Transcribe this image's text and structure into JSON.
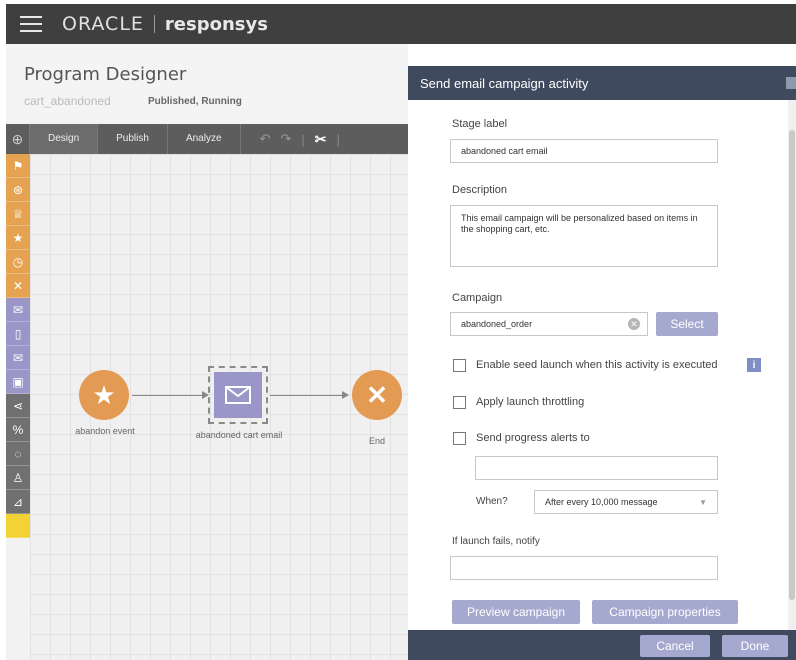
{
  "header": {
    "brand": "ORACLE",
    "product": "responsys"
  },
  "designer": {
    "title": "Program Designer",
    "program_name": "cart_abandoned",
    "status": "Published, Running",
    "tabs": [
      {
        "label": "Design"
      },
      {
        "label": "Publish"
      },
      {
        "label": "Analyze"
      }
    ],
    "toolbar_icons": [
      "undo-icon",
      "redo-icon",
      "scissors-icon"
    ],
    "palette": [
      {
        "icon": "filter-icon",
        "color": "#e5a352"
      },
      {
        "icon": "download-icon",
        "color": "#e5a352"
      },
      {
        "icon": "trophy-icon",
        "color": "#e5a352"
      },
      {
        "icon": "star-icon",
        "color": "#e5a352"
      },
      {
        "icon": "clock-icon",
        "color": "#e5a352"
      },
      {
        "icon": "close-icon",
        "color": "#e5a352"
      },
      {
        "icon": "email-icon",
        "color": "#9b96c8"
      },
      {
        "icon": "mobile-icon",
        "color": "#9b96c8"
      },
      {
        "icon": "email-icon",
        "color": "#9b96c8"
      },
      {
        "icon": "briefcase-icon",
        "color": "#9b96c8"
      },
      {
        "icon": "split-icon",
        "color": "#707070"
      },
      {
        "icon": "percent-icon",
        "color": "#707070"
      },
      {
        "icon": "dotted-circle-icon",
        "color": "#707070"
      },
      {
        "icon": "person-icon",
        "color": "#707070"
      },
      {
        "icon": "chart-icon",
        "color": "#707070"
      },
      {
        "icon": "note-icon",
        "color": "#f2d234"
      }
    ],
    "nodes": {
      "start": {
        "label": "abandon event",
        "icon": "star-icon"
      },
      "email": {
        "label": "abandoned cart email",
        "icon": "email-icon"
      },
      "end": {
        "label": "End",
        "icon": "close-icon"
      }
    }
  },
  "panel": {
    "title": "Send email campaign activity",
    "stage_label": {
      "label": "Stage label",
      "value": "abandoned cart email"
    },
    "description": {
      "label": "Description",
      "value": "This email campaign will be personalized based on items in the shopping cart, etc."
    },
    "campaign": {
      "label": "Campaign",
      "value": "abandoned_order",
      "select_label": "Select"
    },
    "seed_launch": {
      "label": "Enable seed launch when this activity is executed",
      "checked": false,
      "info": "i"
    },
    "throttling": {
      "label": "Apply launch throttling",
      "checked": false
    },
    "progress_alerts": {
      "label": "Send progress alerts to",
      "checked": false,
      "value": "",
      "when_label": "When?",
      "when_value": "After every 10,000 message"
    },
    "launch_fail": {
      "label": "If launch fails, notify",
      "value": ""
    },
    "preview_button": "Preview campaign",
    "properties_button": "Campaign properties",
    "cancel_button": "Cancel",
    "done_button": "Done"
  },
  "colors": {
    "topbar": "#3f3f3f",
    "panel_header": "#3f4a5e",
    "button": "#a6a9cf",
    "orange": "#e5a352",
    "purple": "#9b96c8"
  }
}
